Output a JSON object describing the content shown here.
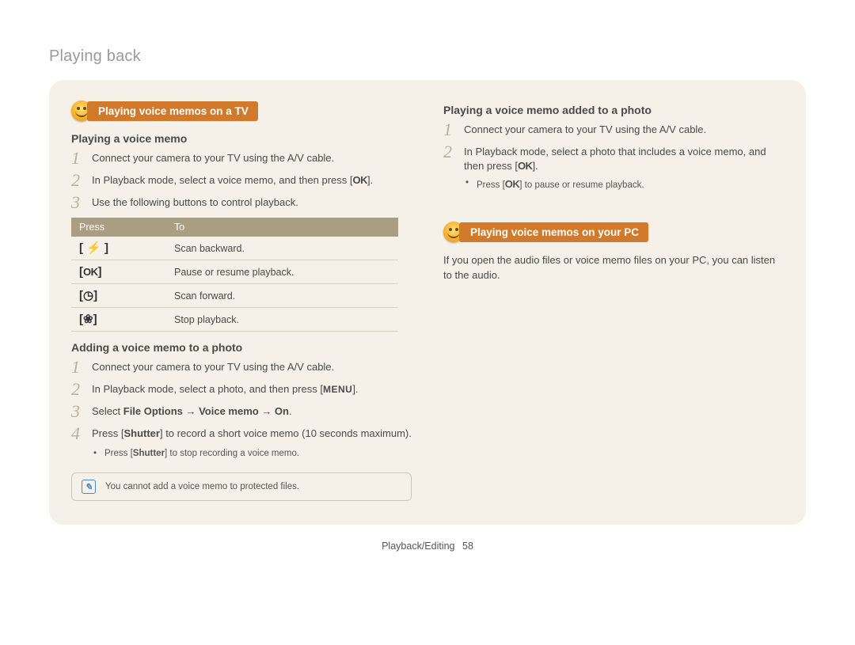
{
  "header": {
    "section_title": "Playing back"
  },
  "left": {
    "pill1": "Playing voice memos on a TV",
    "sub1": "Playing a voice memo",
    "steps1": [
      "Connect your camera to your TV using the A/V cable.",
      "In Playback mode, select a voice memo, and then press [",
      "Use the following buttons to control playback."
    ],
    "ok_close": "].",
    "table": {
      "h1": "Press",
      "h2": "To",
      "rows": [
        {
          "key": "[ ⚡ ]",
          "desc": "Scan backward."
        },
        {
          "key": "[ OK ]",
          "desc": "Pause or resume playback."
        },
        {
          "key": "[ ⏱ ]",
          "desc": "Scan forward."
        },
        {
          "key": "[ 🌷 ]",
          "desc": "Stop playback."
        }
      ]
    },
    "sub2": "Adding a voice memo to a photo",
    "steps2": {
      "s1": "Connect your camera to your TV using the A/V cable.",
      "s2_pre": "In Playback mode, select a photo, and then press [",
      "s2_menu": "MENU",
      "s2_post": "].",
      "s3_pre": "Select ",
      "s3_bold": "File Options → Voice memo → On",
      "s3_post": ".",
      "s4_pre": "Press [",
      "s4_bold": "Shutter",
      "s4_mid": "] to record a short voice memo (10 seconds maximum)."
    },
    "bullet2_pre": "Press [",
    "bullet2_bold": "Shutter",
    "bullet2_post": "] to stop recording a voice memo.",
    "note": "You cannot add a voice memo to protected files."
  },
  "right": {
    "sub1": "Playing a voice memo added to a photo",
    "steps1": {
      "s1": "Connect your camera to your TV using the A/V cable.",
      "s2_pre": "In Playback mode, select a photo that includes a voice memo, and then press [",
      "s2_post": "]."
    },
    "bullet_pre": "Press [",
    "bullet_post": "] to pause or resume playback.",
    "pill2": "Playing voice memos on your PC",
    "para": "If you open the audio files or voice memo files on your PC, you can listen to the audio."
  },
  "footer": {
    "label": "Playback/Editing",
    "page": "58"
  },
  "glyphs": {
    "ok": "OK"
  }
}
